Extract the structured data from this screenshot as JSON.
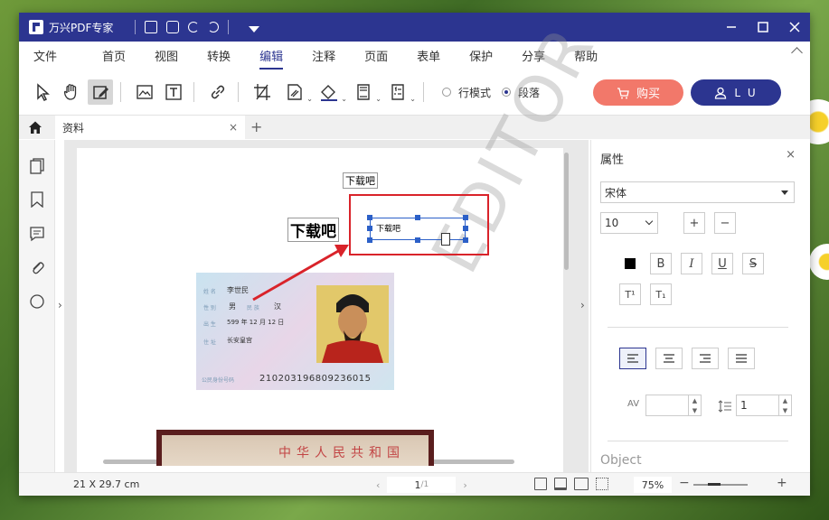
{
  "app": {
    "title": "万兴PDF专家"
  },
  "menu": {
    "items": [
      "文件",
      "首页",
      "视图",
      "转换",
      "编辑",
      "注释",
      "页面",
      "表单",
      "保护",
      "分享",
      "帮助"
    ],
    "active": "编辑"
  },
  "toolbar": {
    "line_mode_label": "行模式",
    "paragraph_mode_label": "段落",
    "buy_label": "购买",
    "user_label": "L U"
  },
  "tabs": {
    "doc_tab_label": "资料",
    "close_glyph": "×",
    "add_glyph": "+"
  },
  "document": {
    "text_small": "下载吧",
    "text_big": "下载吧",
    "selected_text": "下载吧",
    "watermark": "EDITOR",
    "idcard": {
      "name_label": "姓 名",
      "name_value": "李世民",
      "sex_label": "性 别",
      "sex_value": "男",
      "ethnic_label": "民 族",
      "ethnic_value": "汉",
      "birth_label": "出 生",
      "birth_value": "599  年  12  月  12  日",
      "address_label": "住 址",
      "address_value": "长安皇宫",
      "number_label": "公民身份号码",
      "number_value": "210203196809236015"
    },
    "card2_text": "中华人民共和国"
  },
  "properties": {
    "title": "属性",
    "close_glyph": "×",
    "font_family": "宋体",
    "font_size": "10",
    "increase_label": "+",
    "decrease_label": "−",
    "bold_label": "B",
    "italic_label": "I",
    "underline_label": "U",
    "strike_label": "S",
    "superscript_label": "T¹",
    "subscript_label": "T₁",
    "char_spacing_label": "AV",
    "char_spacing_value": "",
    "line_spacing_value": "1",
    "object_label": "Object"
  },
  "status": {
    "page_size": "21 X 29.7 cm",
    "page_current": "1",
    "page_total": "/1",
    "zoom": "75%",
    "zoom_minus": "−",
    "zoom_plus": "+"
  },
  "colors": {
    "primary": "#2c3590",
    "buy": "#f2786a",
    "highlight": "#d9232a"
  }
}
